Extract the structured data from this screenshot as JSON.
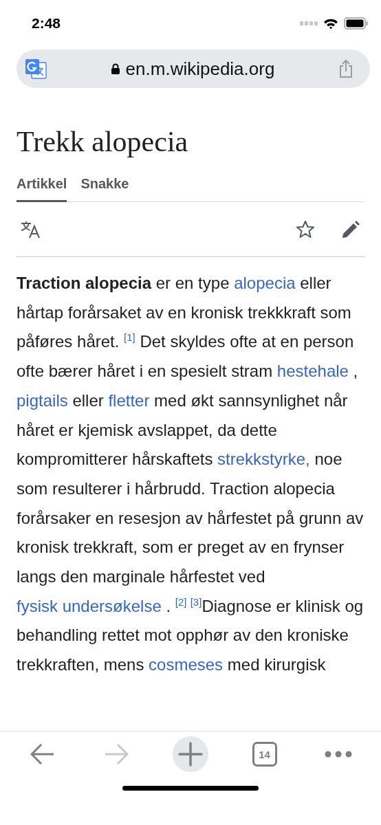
{
  "status_bar": {
    "time": "2:48"
  },
  "address_bar": {
    "url": "en.m.wikipedia.org"
  },
  "article": {
    "title": "Trekk alopecia",
    "tabs": [
      {
        "label": "Artikkel",
        "selected": true
      },
      {
        "label": "Snakke",
        "selected": false
      }
    ],
    "paragraph": [
      {
        "kind": "bold",
        "text": "Traction alopecia"
      },
      {
        "kind": "text",
        "text": " er en type "
      },
      {
        "kind": "link",
        "text": "alopecia"
      },
      {
        "kind": "text",
        "text": " eller hårtap forårsaket av en kronisk trekkkraft som påføres håret. "
      },
      {
        "kind": "ref",
        "text": "[1]"
      },
      {
        "kind": "text",
        "text": " Det skyldes ofte at en person ofte bærer håret i en spesielt stram "
      },
      {
        "kind": "link",
        "text": "hestehale"
      },
      {
        "kind": "text",
        "text": " , "
      },
      {
        "kind": "link",
        "text": "pigtails"
      },
      {
        "kind": "text",
        "text": " eller "
      },
      {
        "kind": "link",
        "text": "fletter"
      },
      {
        "kind": "text",
        "text": " med økt sannsynlighet når håret er kjemisk avslappet, da dette kompromitterer hårskaftets "
      },
      {
        "kind": "link",
        "text": "strekkstyrke,"
      },
      {
        "kind": "text",
        "text": " noe som resulterer i hårbrudd. Traction alopecia forårsaker en resesjon av hårfestet på grunn av kronisk trekkraft, som er preget av en frynser langs den marginale hårfestet ved "
      },
      {
        "kind": "link",
        "text": "fysisk undersøkelse"
      },
      {
        "kind": "text",
        "text": " . "
      },
      {
        "kind": "ref",
        "text": "[2]"
      },
      {
        "kind": "ref",
        "text": "[3]"
      },
      {
        "kind": "text",
        "text": "Diagnose er klinisk og behandling rettet mot opphør av den kroniske trekkraften, mens "
      },
      {
        "kind": "link",
        "text": "cosmeses"
      },
      {
        "kind": "text",
        "text": " med kirurgisk"
      }
    ]
  },
  "toolbar": {
    "buttons": [
      {
        "kind": "back",
        "disabled": false
      },
      {
        "kind": "forward",
        "disabled": true
      },
      {
        "kind": "new_tab",
        "disabled": false
      },
      {
        "kind": "tabs",
        "label": "14",
        "disabled": false
      },
      {
        "kind": "more",
        "disabled": false
      }
    ]
  }
}
